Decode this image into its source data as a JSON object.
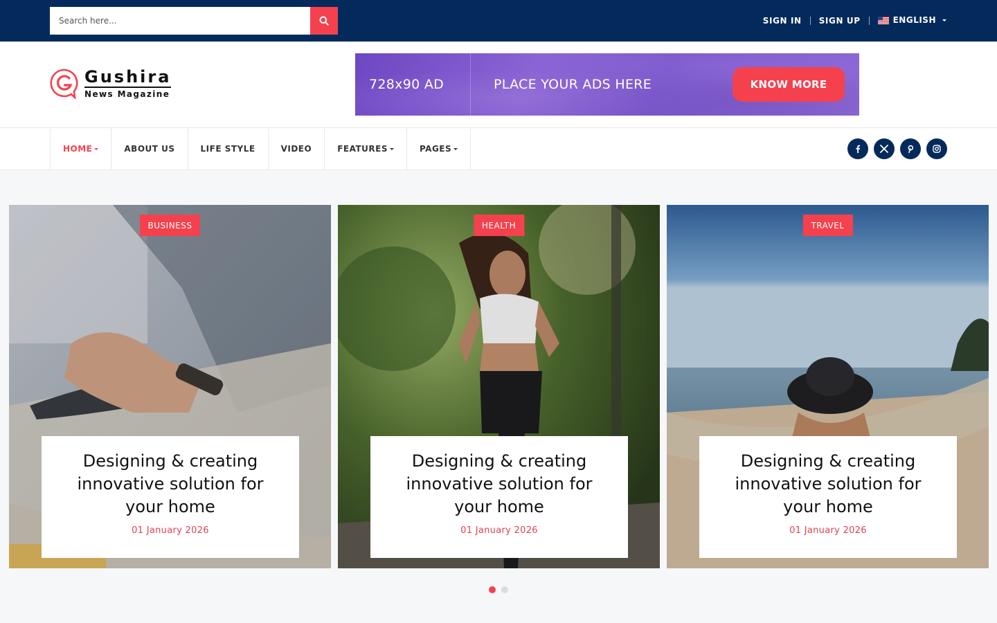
{
  "search": {
    "placeholder": "Search here..."
  },
  "top_links": {
    "sign_in": "SIGN IN",
    "sign_up": "SIGN UP",
    "language": "ENGLISH"
  },
  "brand": {
    "name": "Gushira",
    "tagline": "News Magazine"
  },
  "ad": {
    "size": "728x90 AD",
    "title": "PLACE YOUR ADS HERE",
    "button": "KNOW MORE"
  },
  "nav": {
    "items": [
      {
        "label": "HOME"
      },
      {
        "label": "ABOUT US"
      },
      {
        "label": "LIFE STYLE"
      },
      {
        "label": "VIDEO"
      },
      {
        "label": "FEATURES"
      },
      {
        "label": "PAGES"
      }
    ]
  },
  "social": [
    "facebook-icon",
    "x-icon",
    "pinterest-icon",
    "instagram-icon"
  ],
  "slides": [
    {
      "category": "BUSINESS",
      "title": "Designing & creating innovative solution for your home",
      "date": "01 January 2026"
    },
    {
      "category": "HEALTH",
      "title": "Designing & creating innovative solution for your home",
      "date": "01 January 2026"
    },
    {
      "category": "TRAVEL",
      "title": "Designing & creating innovative solution for your home",
      "date": "01 January 2026"
    }
  ],
  "colors": {
    "navy": "#032a5b",
    "accent": "#f5414d",
    "ad_purple": "#7a55cc"
  }
}
